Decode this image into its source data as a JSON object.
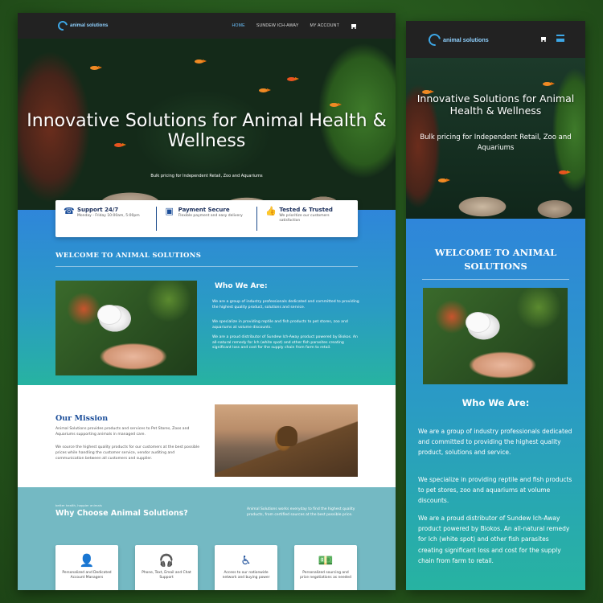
{
  "brand": {
    "logo_text": "animal solutions",
    "accent": "#3da7e6"
  },
  "nav": {
    "items": [
      "HOME",
      "SUNDEW ICH-AWAY",
      "MY ACCOUNT"
    ],
    "active": "HOME"
  },
  "hero": {
    "title": "Innovative Solutions for Animal Health & Wellness",
    "subtitle": "Bulk pricing for Independent Retail, Zoo and Aquariums"
  },
  "features": [
    {
      "icon": "phone-clock-icon",
      "title": "Support 24/7",
      "desc": "Monday - Friday 10:00am, 5:00pm"
    },
    {
      "icon": "credit-card-icon",
      "title": "Payment Secure",
      "desc": "Flexible payment and easy delivery"
    },
    {
      "icon": "thumbs-up-icon",
      "title": "Tested & Trusted",
      "desc": "We prioritize our customers satisfaction"
    }
  ],
  "welcome": {
    "heading": "WELCOME TO ANIMAL SOLUTIONS",
    "who_title": "Who We Are:",
    "paragraphs": [
      "We are a group of industry professionals dedicated and committed to providing the highest quality product, solutions and service.",
      "We specialize in providing reptile and fish products to pet stores, zoo and aquariums at volume discounts.",
      "We are a proud distributor of Sundew Ich-Away product powered by Biokos. An all-natural remedy for Ich (white spot) and other fish parasites creating significant loss and cost for the supply chain from farm to retail."
    ]
  },
  "mission": {
    "title": "Our Mission",
    "paragraphs": [
      "Animal Solutions provides products and services to Pet Stores, Zoos and Aquariums supporting animals in managed care.",
      "We source the highest quality products for our customers at the best possible prices while handling the customer service, vendor auditing and communication between all customers and supplier."
    ]
  },
  "why": {
    "eyebrow": "better health, happier animals",
    "title": "Why Choose Animal Solutions?",
    "desc": "Animal Solutions works everyday to find the highest quality products, from certified sources at the best possible price.",
    "cards": [
      {
        "icon": "user-shield-icon",
        "text": "Personalized and Dedicated Account Managers"
      },
      {
        "icon": "headset-icon",
        "text": "Phone, Text, Email and Chat Support"
      },
      {
        "icon": "accessibility-icon",
        "text": "Access to our nationwide network and buying power"
      },
      {
        "icon": "money-bill-icon",
        "text": "Personalized sourcing and price negotiations as needed"
      }
    ]
  }
}
